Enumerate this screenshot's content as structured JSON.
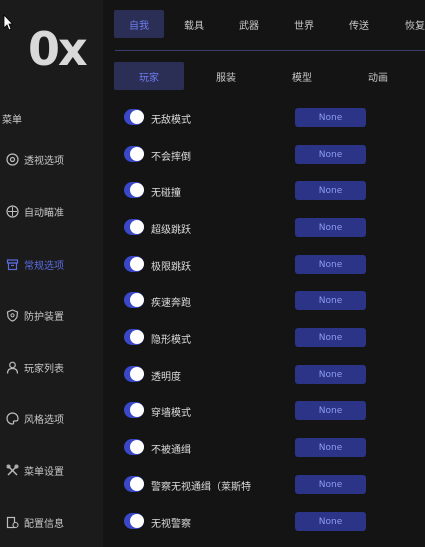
{
  "logo": "0x",
  "sidebar": {
    "title": "菜单",
    "items": [
      {
        "label": "透视选项",
        "icon": "eye-icon"
      },
      {
        "label": "自动瞄准",
        "icon": "crosshair-icon"
      },
      {
        "label": "常规选项",
        "icon": "archive-icon",
        "active": true
      },
      {
        "label": "防护装置",
        "icon": "shield-icon"
      },
      {
        "label": "玩家列表",
        "icon": "user-icon"
      },
      {
        "label": "风格选项",
        "icon": "palette-icon"
      },
      {
        "label": "菜单设置",
        "icon": "tools-icon"
      },
      {
        "label": "配置信息",
        "icon": "config-icon"
      }
    ]
  },
  "tabs": [
    "自我",
    "载具",
    "武器",
    "世界",
    "传送",
    "恢复"
  ],
  "active_tab": "自我",
  "subtabs": [
    "玩家",
    "服装",
    "模型",
    "动画"
  ],
  "active_subtab": "玩家",
  "rows": [
    {
      "label": "无敌模式",
      "value": "None"
    },
    {
      "label": "不会摔倒",
      "value": "None"
    },
    {
      "label": "无碰撞",
      "value": "None"
    },
    {
      "label": "超级跳跃",
      "value": "None"
    },
    {
      "label": "极限跳跃",
      "value": "None"
    },
    {
      "label": "疾速奔跑",
      "value": "None"
    },
    {
      "label": "隐形模式",
      "value": "None"
    },
    {
      "label": "透明度",
      "value": "None"
    },
    {
      "label": "穿墙模式",
      "value": "None"
    },
    {
      "label": "不被通缉",
      "value": "None"
    },
    {
      "label": "警察无视通缉（莱斯特",
      "value": "None"
    },
    {
      "label": "无视警察",
      "value": "None"
    }
  ],
  "colors": {
    "accent": "#3a48c8",
    "active_text": "#6d7cf0",
    "combo_bg": "#2b3487",
    "background": "#141414",
    "sidebar_bg": "#1b1b1b"
  }
}
